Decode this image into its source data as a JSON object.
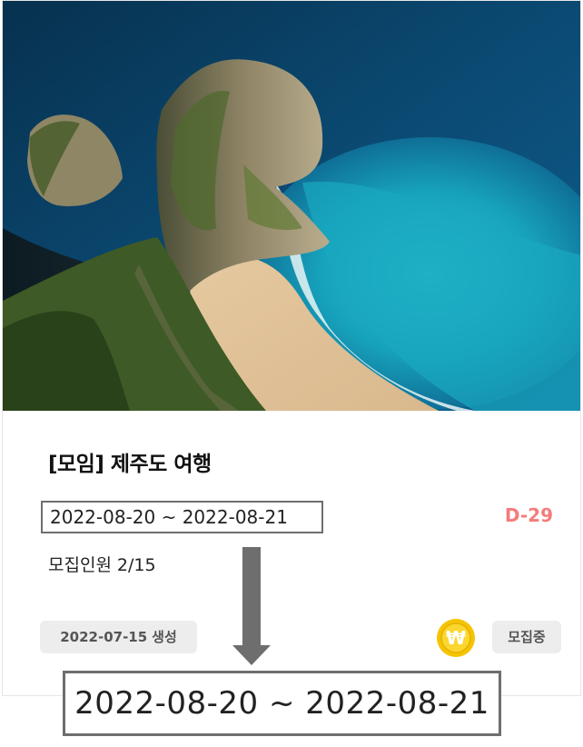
{
  "card": {
    "title": "[모임] 제주도 여행",
    "date_range": "2022-08-20 ~ 2022-08-21",
    "d_day": "D-29",
    "members_label": "모집인원",
    "members_count": "2/15",
    "created_date": "2022-07-15",
    "created_suffix": "생성",
    "status": "모집중",
    "coin_icon": "won-coin-icon",
    "coin_symbol": "₩"
  },
  "zoom": {
    "date_range": "2022-08-20 ~ 2022-08-21"
  },
  "colors": {
    "d_day": "#f47c7c",
    "chip_bg": "#ededed",
    "coin": "#f5c400",
    "highlight_border": "#6e6e6e"
  }
}
